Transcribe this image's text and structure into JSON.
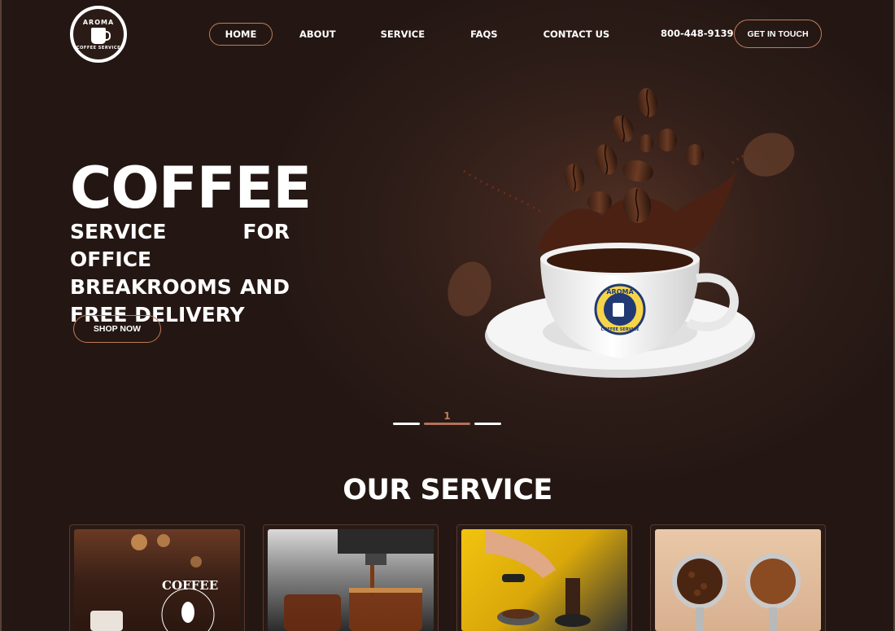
{
  "brand": {
    "logo_top": "AROMA",
    "logo_bottom": "COFFEE SERVICE"
  },
  "nav": {
    "items": [
      {
        "label": "HOME",
        "active": true
      },
      {
        "label": "ABOUT",
        "active": false
      },
      {
        "label": "SERVICE",
        "active": false
      },
      {
        "label": "FAQS",
        "active": false
      },
      {
        "label": "CONTACT US",
        "active": false
      }
    ]
  },
  "header": {
    "phone": "800-448-9139",
    "cta_label": "GET IN TOUCH"
  },
  "hero": {
    "title": "COFFEE",
    "subtitle": "SERVICE FOR OFFICE BREAKROOMS AND FREE DELIVERY",
    "cta_label": "SHOP NOW",
    "cup_logo_top": "AROMA",
    "cup_logo_bottom": "COFFEE SERVICE"
  },
  "slider": {
    "current": "1"
  },
  "services": {
    "title": "OUR SERVICE",
    "cards": [
      {
        "image": "coffee-shop-sign",
        "text": "COFFEE"
      },
      {
        "image": "espresso-machine-pouring"
      },
      {
        "image": "barista-tamping"
      },
      {
        "image": "portafilters-beans-grounds"
      }
    ]
  },
  "colors": {
    "background": "#2e1d18",
    "accent": "#c07a5a",
    "text": "#ffffff"
  }
}
